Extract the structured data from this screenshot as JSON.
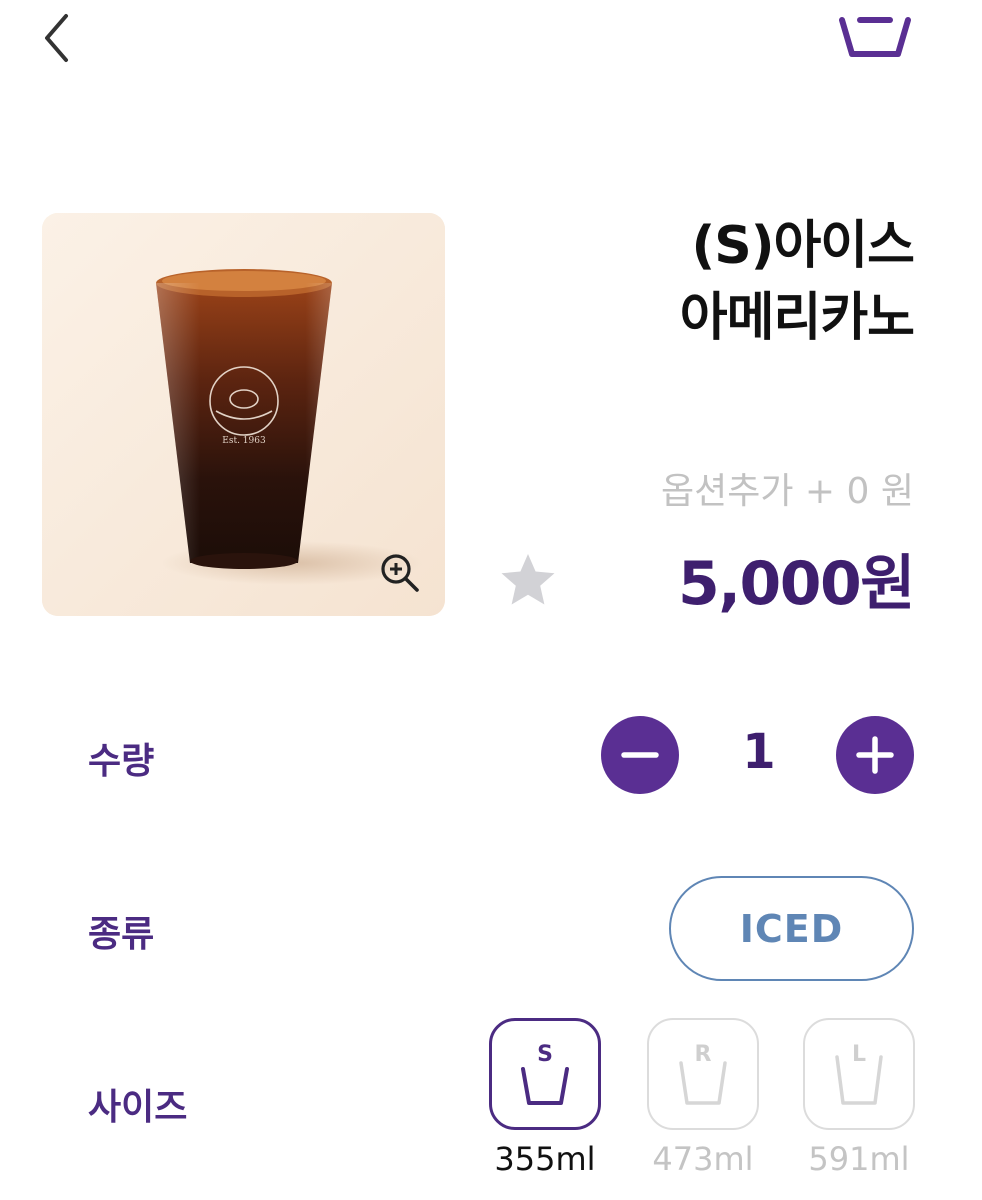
{
  "header": {
    "back_icon": "chevron-left-icon",
    "cart_icon": "cart-basket-icon"
  },
  "product": {
    "name_line1": "(S)아이스",
    "name_line2": "아메리카노",
    "image_icon": "iced-americano-cup-image",
    "zoom_icon": "zoom-in-icon",
    "option_add_label": "옵션추가",
    "option_add_value": "+ 0 원",
    "price": "5,000원",
    "favorite_icon": "star-icon"
  },
  "quantity": {
    "label": "수량",
    "value": "1",
    "minus_icon": "minus-icon",
    "plus_icon": "plus-icon"
  },
  "type": {
    "label": "종류",
    "selected": "ICED"
  },
  "size": {
    "label": "사이즈",
    "options": [
      {
        "letter": "S",
        "volume": "355ml",
        "selected": true
      },
      {
        "letter": "R",
        "volume": "473ml",
        "selected": false
      },
      {
        "letter": "L",
        "volume": "591ml",
        "selected": false
      }
    ]
  },
  "colors": {
    "brand_purple": "#4b2b82",
    "price_purple": "#3e1f6e",
    "iced_blue": "#5f86b5",
    "muted_gray": "#c4c4c4"
  }
}
